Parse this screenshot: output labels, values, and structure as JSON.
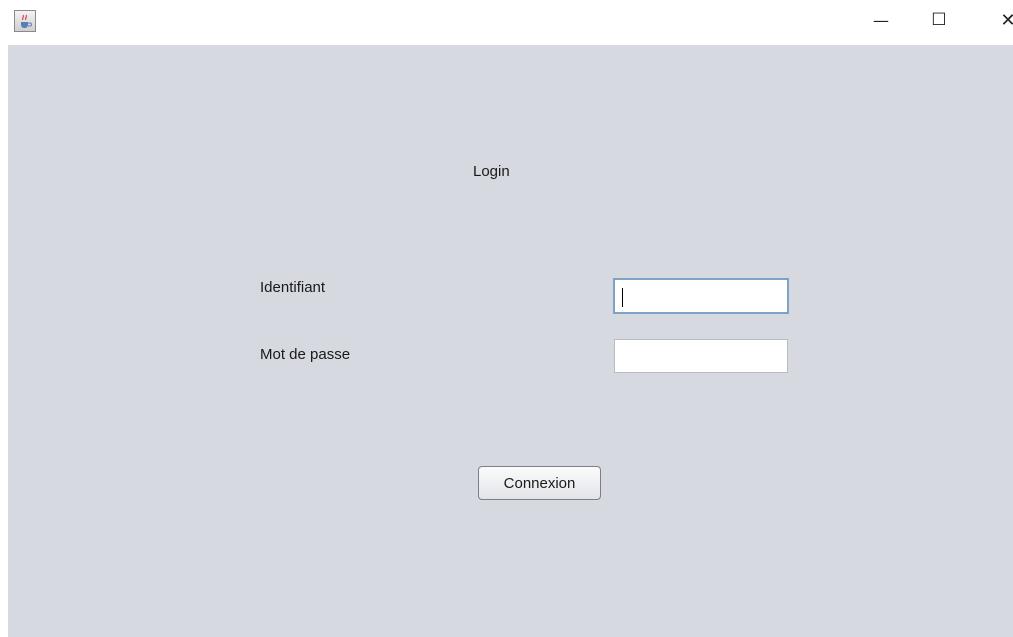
{
  "window": {
    "title": "",
    "app_icon": "java-cup-icon",
    "controls": {
      "minimize": "—",
      "maximize": "☐",
      "close": "✕"
    }
  },
  "form": {
    "title": "Login",
    "identifier_label": "Identifiant",
    "identifier_value": "",
    "password_label": "Mot de passe",
    "password_value": "",
    "submit_label": "Connexion"
  },
  "colors": {
    "panel_background": "#d6d9e0",
    "focus_border": "#7ea1c9"
  }
}
